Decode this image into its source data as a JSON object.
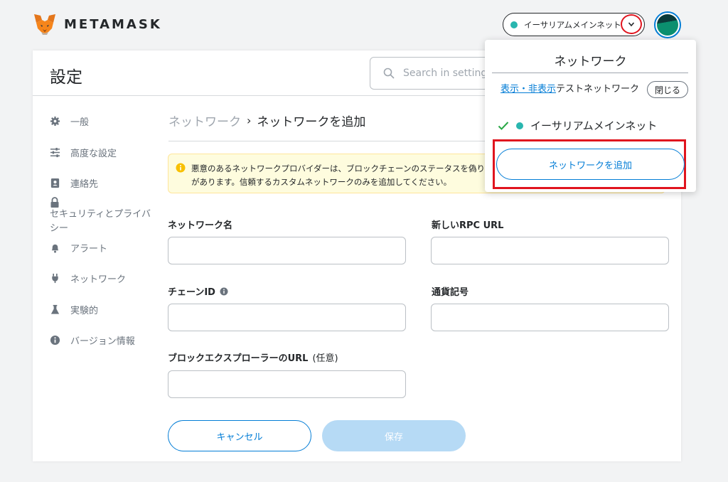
{
  "header": {
    "brand": "METAMASK",
    "network_label": "イーサリアムメインネット",
    "network_color": "#29b6af"
  },
  "settings": {
    "title": "設定",
    "search_placeholder": "Search in settings"
  },
  "sidebar": {
    "items": [
      {
        "label": "一般",
        "icon": "gear-icon"
      },
      {
        "label": "高度な設定",
        "icon": "sliders-icon"
      },
      {
        "label": "連絡先",
        "icon": "contact-book-icon"
      },
      {
        "label": "セキュリティとプライバシー",
        "icon": "lock-icon"
      },
      {
        "label": "アラート",
        "icon": "bell-icon"
      },
      {
        "label": "ネットワーク",
        "icon": "plug-icon"
      },
      {
        "label": "実験的",
        "icon": "flask-icon"
      },
      {
        "label": "バージョン情報",
        "icon": "info-icon"
      }
    ]
  },
  "breadcrumb": {
    "parent": "ネットワーク",
    "separator": "›",
    "current": "ネットワークを追加"
  },
  "warning": {
    "text": "悪意のあるネットワークプロバイダーは、ブロックチェーンのステータスを偽り、ネットワークアクティビティを記録することがあります。信頼するカスタムネットワークのみを追加してください。"
  },
  "form": {
    "network_name_label": "ネットワーク名",
    "rpc_url_label": "新しいRPC URL",
    "chain_id_label": "チェーンID",
    "currency_symbol_label": "通貨記号",
    "explorer_url_label": "ブロックエクスプローラーのURL",
    "explorer_optional": "(任意)",
    "cancel_label": "キャンセル",
    "save_label": "保存"
  },
  "network_menu": {
    "title": "ネットワーク",
    "toggle_link": "表示・非表示",
    "toggle_suffix": "テストネットワーク",
    "close_label": "閉じる",
    "selected_network": "イーサリアムメインネット",
    "add_network_label": "ネットワークを追加"
  },
  "colors": {
    "accent": "#037dd6",
    "highlight": "#e0141e",
    "warning_bg": "#fefcde"
  }
}
